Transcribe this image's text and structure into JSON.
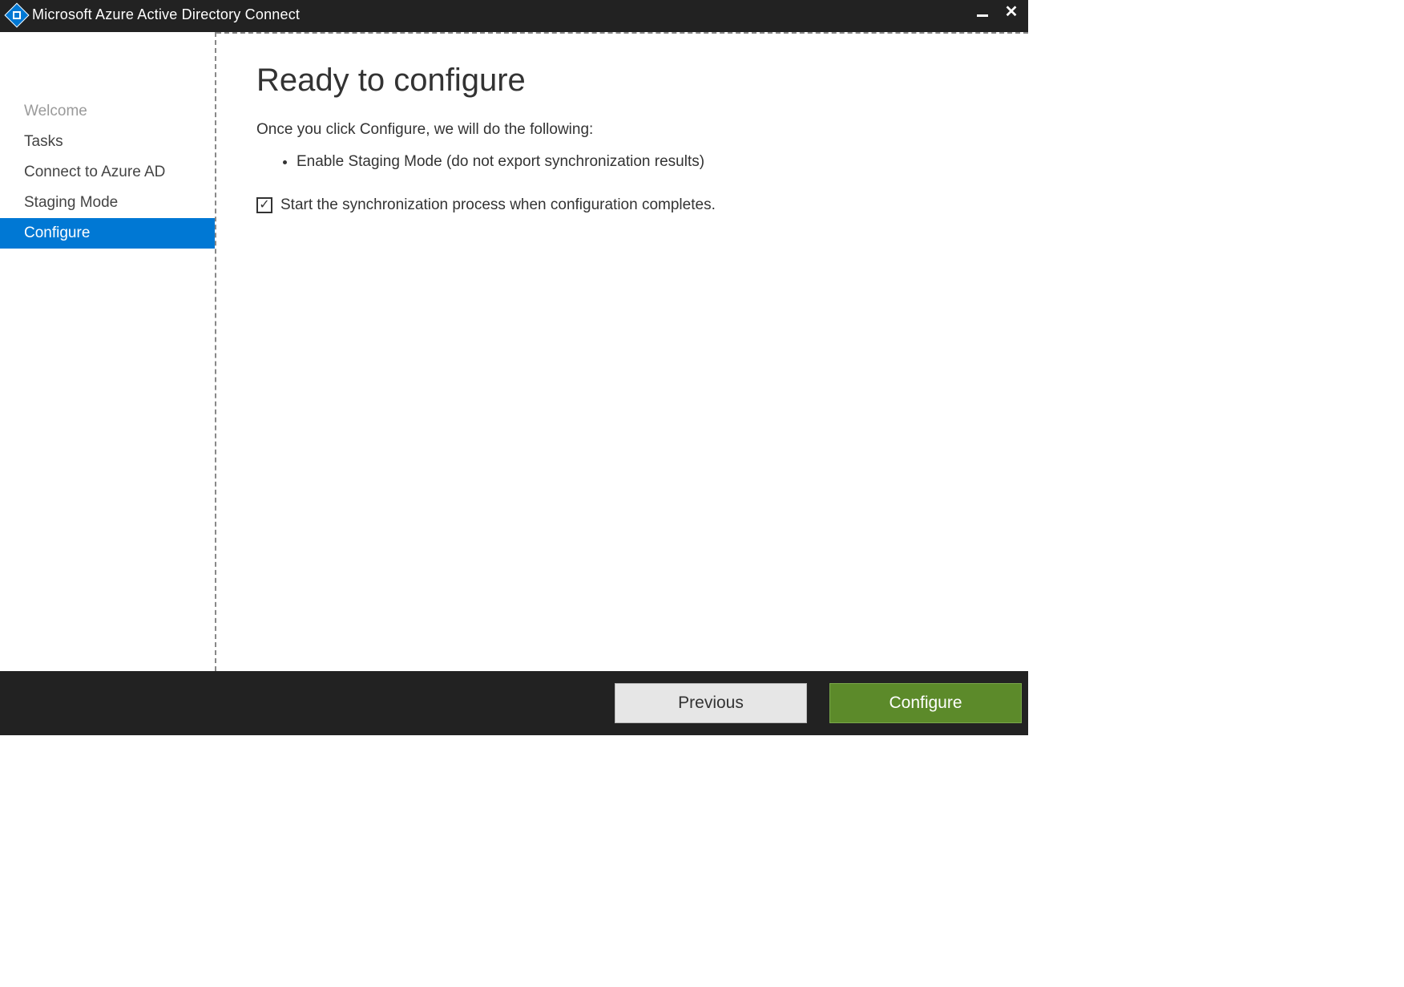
{
  "titlebar": {
    "title": "Microsoft Azure Active Directory Connect"
  },
  "sidebar": {
    "items": [
      {
        "label": "Welcome",
        "state": "disabled"
      },
      {
        "label": "Tasks",
        "state": "normal"
      },
      {
        "label": "Connect to Azure AD",
        "state": "normal"
      },
      {
        "label": "Staging Mode",
        "state": "normal"
      },
      {
        "label": "Configure",
        "state": "active"
      }
    ]
  },
  "main": {
    "heading": "Ready to configure",
    "intro": "Once you click Configure, we will do the following:",
    "bullets": [
      "Enable Staging Mode (do not export synchronization results)"
    ],
    "checkbox": {
      "checked": true,
      "label": "Start the synchronization process when configuration completes."
    }
  },
  "footer": {
    "previous": "Previous",
    "configure": "Configure"
  }
}
